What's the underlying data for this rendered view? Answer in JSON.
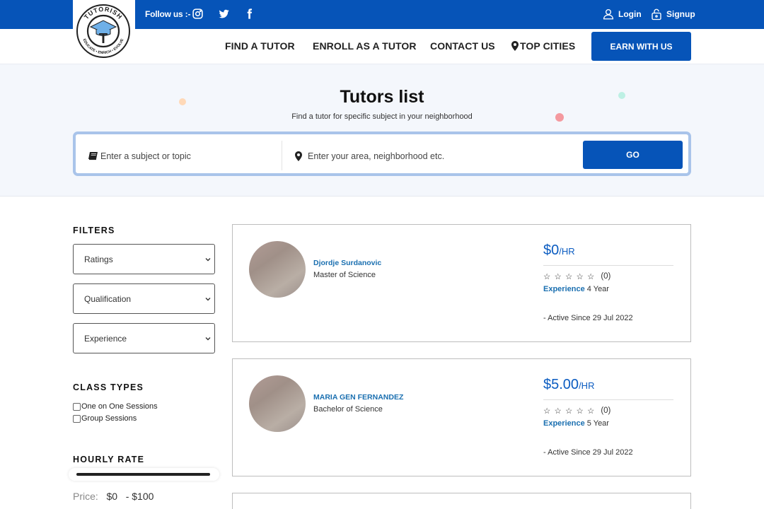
{
  "header": {
    "follow_label": "Follow us :-",
    "login_label": "Login",
    "signup_label": "Signup",
    "logo_text_top": "TUTORISH",
    "logo_text_bottom": "EDUCATE • ENRICH • EVOLVE",
    "logo_letter": "T"
  },
  "nav": {
    "find_tutor": "FIND A TUTOR",
    "enroll": "ENROLL AS A TUTOR",
    "contact": "CONTACT US",
    "top_cities": "TOP CITIES",
    "earn": "EARN WITH US"
  },
  "hero": {
    "title": "Tutors list",
    "subtitle": "Find a tutor for specific subject in your neighborhood",
    "subject_placeholder": "Enter a subject or topic",
    "area_placeholder": "Enter your area, neighborhood etc.",
    "go_label": "GO"
  },
  "filters": {
    "title": "FILTERS",
    "ratings": "Ratings",
    "qualification": "Qualification",
    "experience": "Experience",
    "class_types_title": "CLASS TYPES",
    "class_types": [
      "One on One Sessions",
      "Group Sessions"
    ],
    "hourly_rate_title": "HOURLY RATE",
    "price_label": "Price:",
    "price_min": "$0",
    "price_max": "- $100"
  },
  "tutors": [
    {
      "name": "Djordje Surdanovic",
      "degree": "Master of Science",
      "rate": "$0",
      "rate_unit": "/HR",
      "stars": "☆ ☆ ☆ ☆ ☆",
      "reviews": "(0)",
      "experience_label": "Experience",
      "experience_value": "4 Year",
      "active_since": "- Active Since 29 Jul 2022"
    },
    {
      "name": "MARIA GEN FERNANDEZ",
      "degree": "Bachelor of Science",
      "rate": "$5.00",
      "rate_unit": "/HR",
      "stars": "☆ ☆ ☆ ☆ ☆",
      "reviews": "(0)",
      "experience_label": "Experience",
      "experience_value": "5 Year",
      "active_since": "- Active Since 29 Jul 2022"
    }
  ],
  "colors": {
    "brand_blue": "#0654b8",
    "link_blue": "#1a6fb0",
    "hero_bg": "#f4f7fc",
    "search_border": "#a9c4ea"
  },
  "icons": [
    "instagram-icon",
    "twitter-icon",
    "facebook-icon",
    "user-icon",
    "lock-icon",
    "map-pin-icon",
    "book-icon",
    "chevron-down-icon",
    "star-icon"
  ]
}
